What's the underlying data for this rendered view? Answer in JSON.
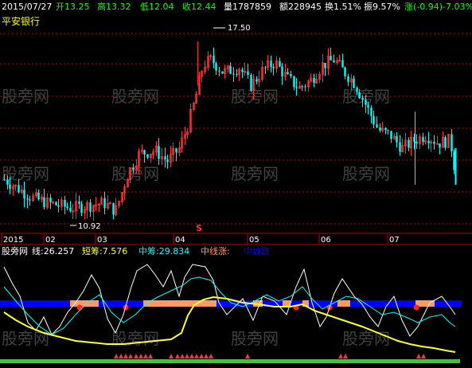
{
  "header": {
    "date": "2015/07/27",
    "open": "开13.25",
    "high": "高13.32",
    "low": "低12.04",
    "close": "收12.44",
    "volume": "量1787859",
    "amount": "额228945",
    "turnover": "换1.51%",
    "amplitude": "振9.57%",
    "change": "涨(-0.94)-7.03%"
  },
  "stock_name": "平安银行",
  "watermark": "股旁网",
  "annotations": {
    "high_price": "17.50",
    "low_price": "10.92",
    "marker": "S"
  },
  "time_axis": [
    "2015",
    "02",
    "03",
    "04",
    "05",
    "06",
    "07"
  ],
  "indicator": {
    "name": "股旁网",
    "line1": "线:26.257",
    "line2": "短筹:7.576",
    "line3": "中筹:29.834",
    "line4": "中线涨:",
    "line5": "中线跌"
  },
  "colors": {
    "up": "#ff3333",
    "down": "#00ffff",
    "grid": "#c00000",
    "bar_blue": "#0000ff",
    "bar_orange": "#ff9966",
    "yellow": "#ffff33",
    "cyan": "#00ffff",
    "green": "#33cc33"
  },
  "chart_data": {
    "type": "candlestick",
    "x_labels": [
      "2015",
      "02",
      "03",
      "04",
      "05",
      "06",
      "07"
    ],
    "max_annotation": 17.5,
    "min_annotation": 10.92,
    "ohlc_samples": [
      [
        11.6,
        11.9,
        11.3,
        11.7
      ],
      [
        11.7,
        12.0,
        11.4,
        11.5
      ],
      [
        11.5,
        11.7,
        11.0,
        11.2
      ],
      [
        11.2,
        11.5,
        10.9,
        11.4
      ],
      [
        11.4,
        11.6,
        11.1,
        11.3
      ],
      [
        11.3,
        11.8,
        11.2,
        11.7
      ],
      [
        11.7,
        12.1,
        11.6,
        12.0
      ],
      [
        12.0,
        12.6,
        11.9,
        12.4
      ],
      [
        12.4,
        13.2,
        12.3,
        13.0
      ],
      [
        13.0,
        13.4,
        12.6,
        12.8
      ],
      [
        12.8,
        13.0,
        12.5,
        12.9
      ],
      [
        12.9,
        13.5,
        12.8,
        13.3
      ],
      [
        13.3,
        14.5,
        13.2,
        14.3
      ],
      [
        14.3,
        15.6,
        14.1,
        15.4
      ],
      [
        15.4,
        17.5,
        15.2,
        16.6
      ],
      [
        16.6,
        17.2,
        15.8,
        16.1
      ],
      [
        16.1,
        16.9,
        15.6,
        16.5
      ],
      [
        16.5,
        17.0,
        15.9,
        16.3
      ],
      [
        16.3,
        16.8,
        15.7,
        16.0
      ],
      [
        16.0,
        16.4,
        15.3,
        15.6
      ],
      [
        15.6,
        16.2,
        15.2,
        15.9
      ],
      [
        15.9,
        16.6,
        15.7,
        16.4
      ],
      [
        16.4,
        17.1,
        16.1,
        16.8
      ],
      [
        16.8,
        17.3,
        16.0,
        16.2
      ],
      [
        16.2,
        16.5,
        15.0,
        15.2
      ],
      [
        15.2,
        15.5,
        14.0,
        14.2
      ],
      [
        14.2,
        14.8,
        13.3,
        14.6
      ],
      [
        14.6,
        15.0,
        13.6,
        13.8
      ],
      [
        13.8,
        14.2,
        12.9,
        13.6
      ],
      [
        13.6,
        13.8,
        12.6,
        13.4
      ],
      [
        13.25,
        13.32,
        12.04,
        12.44
      ]
    ]
  }
}
